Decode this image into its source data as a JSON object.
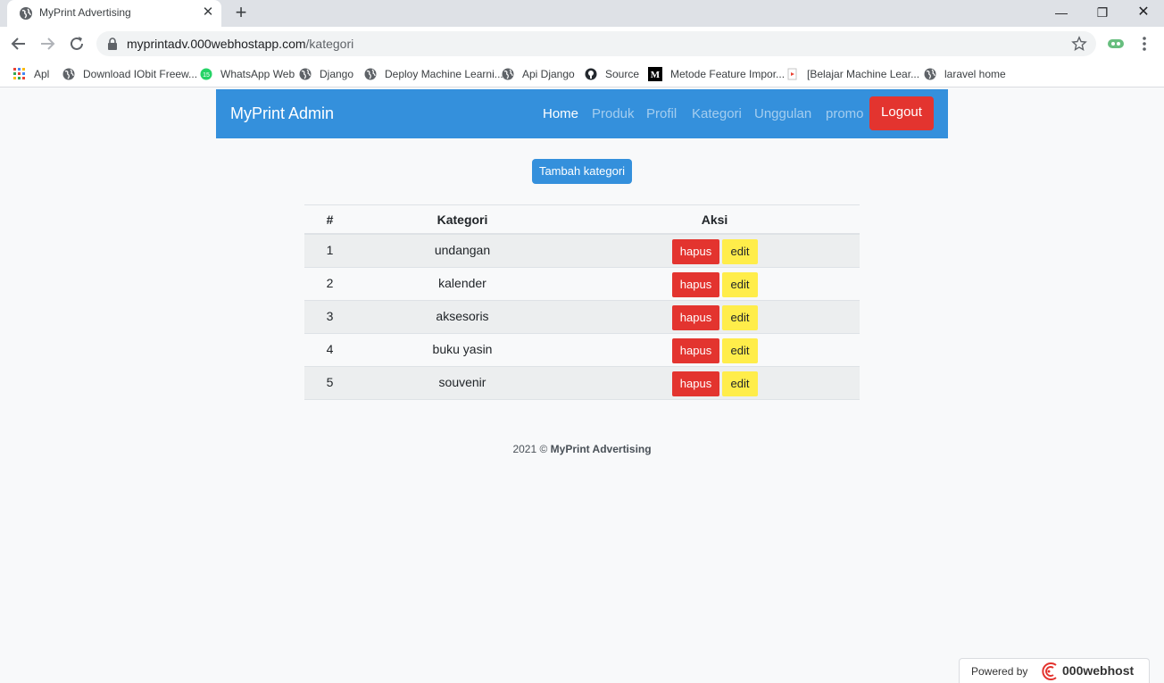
{
  "browser": {
    "tab_title": "MyPrint Advertising",
    "url_host": "myprintadv.000webhostapp.com",
    "url_path": "/kategori",
    "bookmarks": [
      {
        "label": "Apl",
        "icon": "apps-grid-icon"
      },
      {
        "label": "Download IObit Freew...",
        "icon": "globe-icon"
      },
      {
        "label": "WhatsApp Web",
        "icon": "whatsapp-icon",
        "badge": "15"
      },
      {
        "label": "Django",
        "icon": "globe-icon"
      },
      {
        "label": "Deploy Machine Learni...",
        "icon": "globe-icon"
      },
      {
        "label": "Api Django",
        "icon": "globe-icon"
      },
      {
        "label": "Source",
        "icon": "github-icon"
      },
      {
        "label": "Metode Feature Impor...",
        "icon": "medium-icon"
      },
      {
        "label": "[Belajar Machine Lear...",
        "icon": "youtube-icon"
      },
      {
        "label": "laravel home",
        "icon": "globe-icon"
      }
    ]
  },
  "navbar": {
    "brand": "MyPrint Admin",
    "links": [
      "Home",
      "Produk",
      "Profil",
      "Kategori",
      "Unggulan",
      "promo"
    ],
    "active_link": "Home",
    "logout_label": "Logout"
  },
  "main": {
    "add_button_label": "Tambah kategori",
    "table": {
      "headers": [
        "#",
        "Kategori",
        "Aksi"
      ],
      "rows": [
        {
          "num": "1",
          "kategori": "undangan"
        },
        {
          "num": "2",
          "kategori": "kalender"
        },
        {
          "num": "3",
          "kategori": "aksesoris"
        },
        {
          "num": "4",
          "kategori": "buku yasin"
        },
        {
          "num": "5",
          "kategori": "souvenir"
        }
      ],
      "delete_label": "hapus",
      "edit_label": "edit"
    }
  },
  "footer": {
    "year": "2021 ©",
    "brand": "MyPrint Advertising"
  },
  "powered_badge": {
    "prefix": "Powered by",
    "brand": "000webhost"
  },
  "colors": {
    "primary": "#3490dc",
    "danger": "#e3342f",
    "warning": "#ffed4a"
  }
}
